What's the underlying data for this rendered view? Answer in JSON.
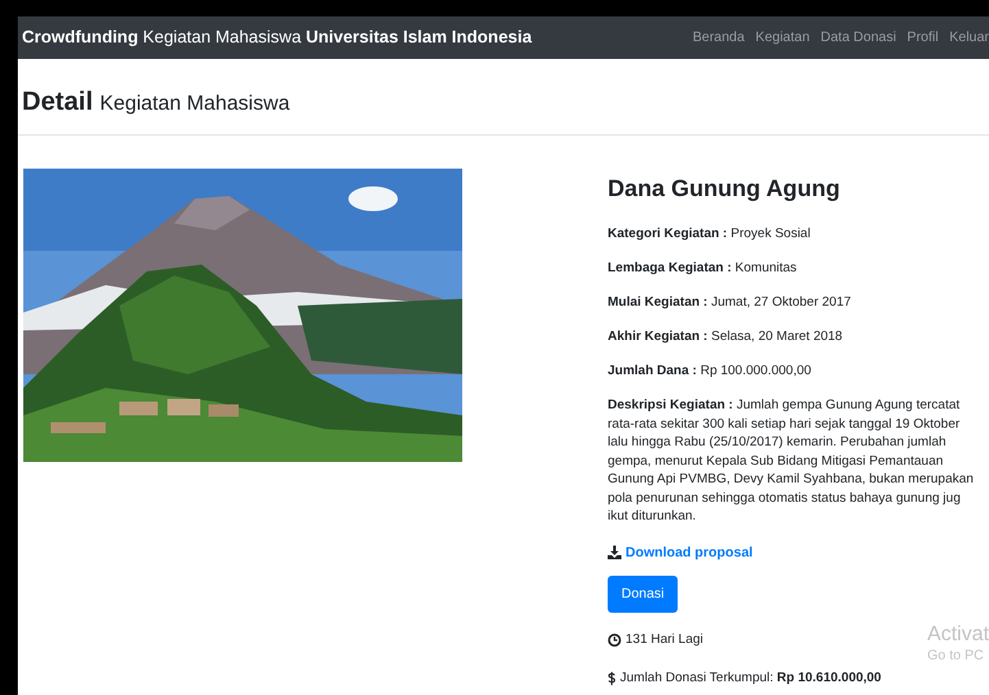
{
  "navbar": {
    "brand": "**Crowdfunding** Kegiatan Mahasiswa **Universitas Islam Indonesia**",
    "links": [
      "Beranda",
      "Kegiatan",
      "Data Donasi",
      "Profil",
      "Keluar"
    ]
  },
  "header": {
    "title": "Detail",
    "subtitle": "Kegiatan Mahasiswa"
  },
  "detail": {
    "title": "Dana Gunung Agung",
    "fields": [
      {
        "label": "Kategori Kegiatan :",
        "value": "Proyek Sosial"
      },
      {
        "label": "Lembaga Kegiatan :",
        "value": "Komunitas"
      },
      {
        "label": "Mulai Kegiatan :",
        "value": "Jumat, 27 Oktober 2017"
      },
      {
        "label": "Akhir Kegiatan :",
        "value": "Selasa, 20 Maret 2018"
      },
      {
        "label": "Jumlah Dana :",
        "value": "Rp 100.000.000,00"
      }
    ],
    "description": {
      "label": "Deskripsi Kegiatan :",
      "lines": [
        "Jumlah gempa Gunung Agung tercatat",
        "rata-rata sekitar 300 kali setiap hari sejak tanggal 19 Oktober",
        "lalu hingga Rabu (25/10/2017) kemarin. Perubahan jumlah",
        "gempa, menurut Kepala Sub Bidang Mitigasi Pemantauan",
        "Gunung Api PVMBG, Devy Kamil Syahbana, bukan merupakan",
        "pola penurunan sehingga otomatis status bahaya gunung jug",
        "ikut diturunkan."
      ]
    },
    "download_link": "Download proposal",
    "donate_button": "Donasi",
    "days_left": "131 Hari Lagi",
    "collected": "Jumlah Donasi Terkumpul: **Rp 10.610.000,00**"
  },
  "activation_notice": {
    "title": "Activat",
    "subtitle": "Go to PC"
  }
}
